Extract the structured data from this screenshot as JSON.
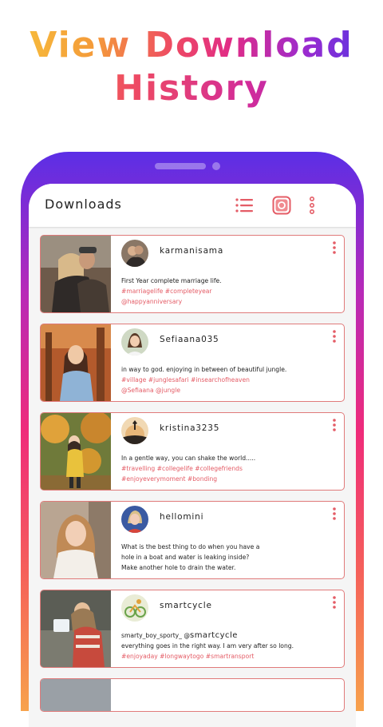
{
  "promo": {
    "line1": "View Download",
    "line2": "History"
  },
  "appbar": {
    "title": "Downloads",
    "icons": [
      "list-icon",
      "instagram-icon",
      "more-vert-icon"
    ],
    "accent": "#e45c66"
  },
  "posts": [
    {
      "username": "karmanisama",
      "caption": "First Year complete marriage life.",
      "tags_1": "#marriagelife #completeyear",
      "tags_2": "@happyanniversary"
    },
    {
      "username": "Sefiaana035",
      "caption": "in way to god. enjoying in between of beautiful jungle.",
      "tags_1": "#village #junglesafari #insearchofheaven",
      "tags_2": "@Sefiaana @jungle"
    },
    {
      "username": "kristina3235",
      "caption": "In a gentle way, you can shake the world.....",
      "tags_1": "#travelling #collegelife #collegefriends",
      "tags_2": "#enjoyeverymoment #bonding"
    },
    {
      "username": "hellomini",
      "line_1": "What is the best thing to do when you have a",
      "line_2": "hole in a boat and water is leaking inside?",
      "line_3": "Make another hole to drain the water."
    },
    {
      "username": "smartcycle",
      "caption_a": "smarty_boy_sporty_ @",
      "caption_b": "smartcycle",
      "caption_2": "everything goes in the right way. I am very after so long.",
      "tags_1": "#enjoyaday #longwaytogo #smartransport"
    }
  ]
}
